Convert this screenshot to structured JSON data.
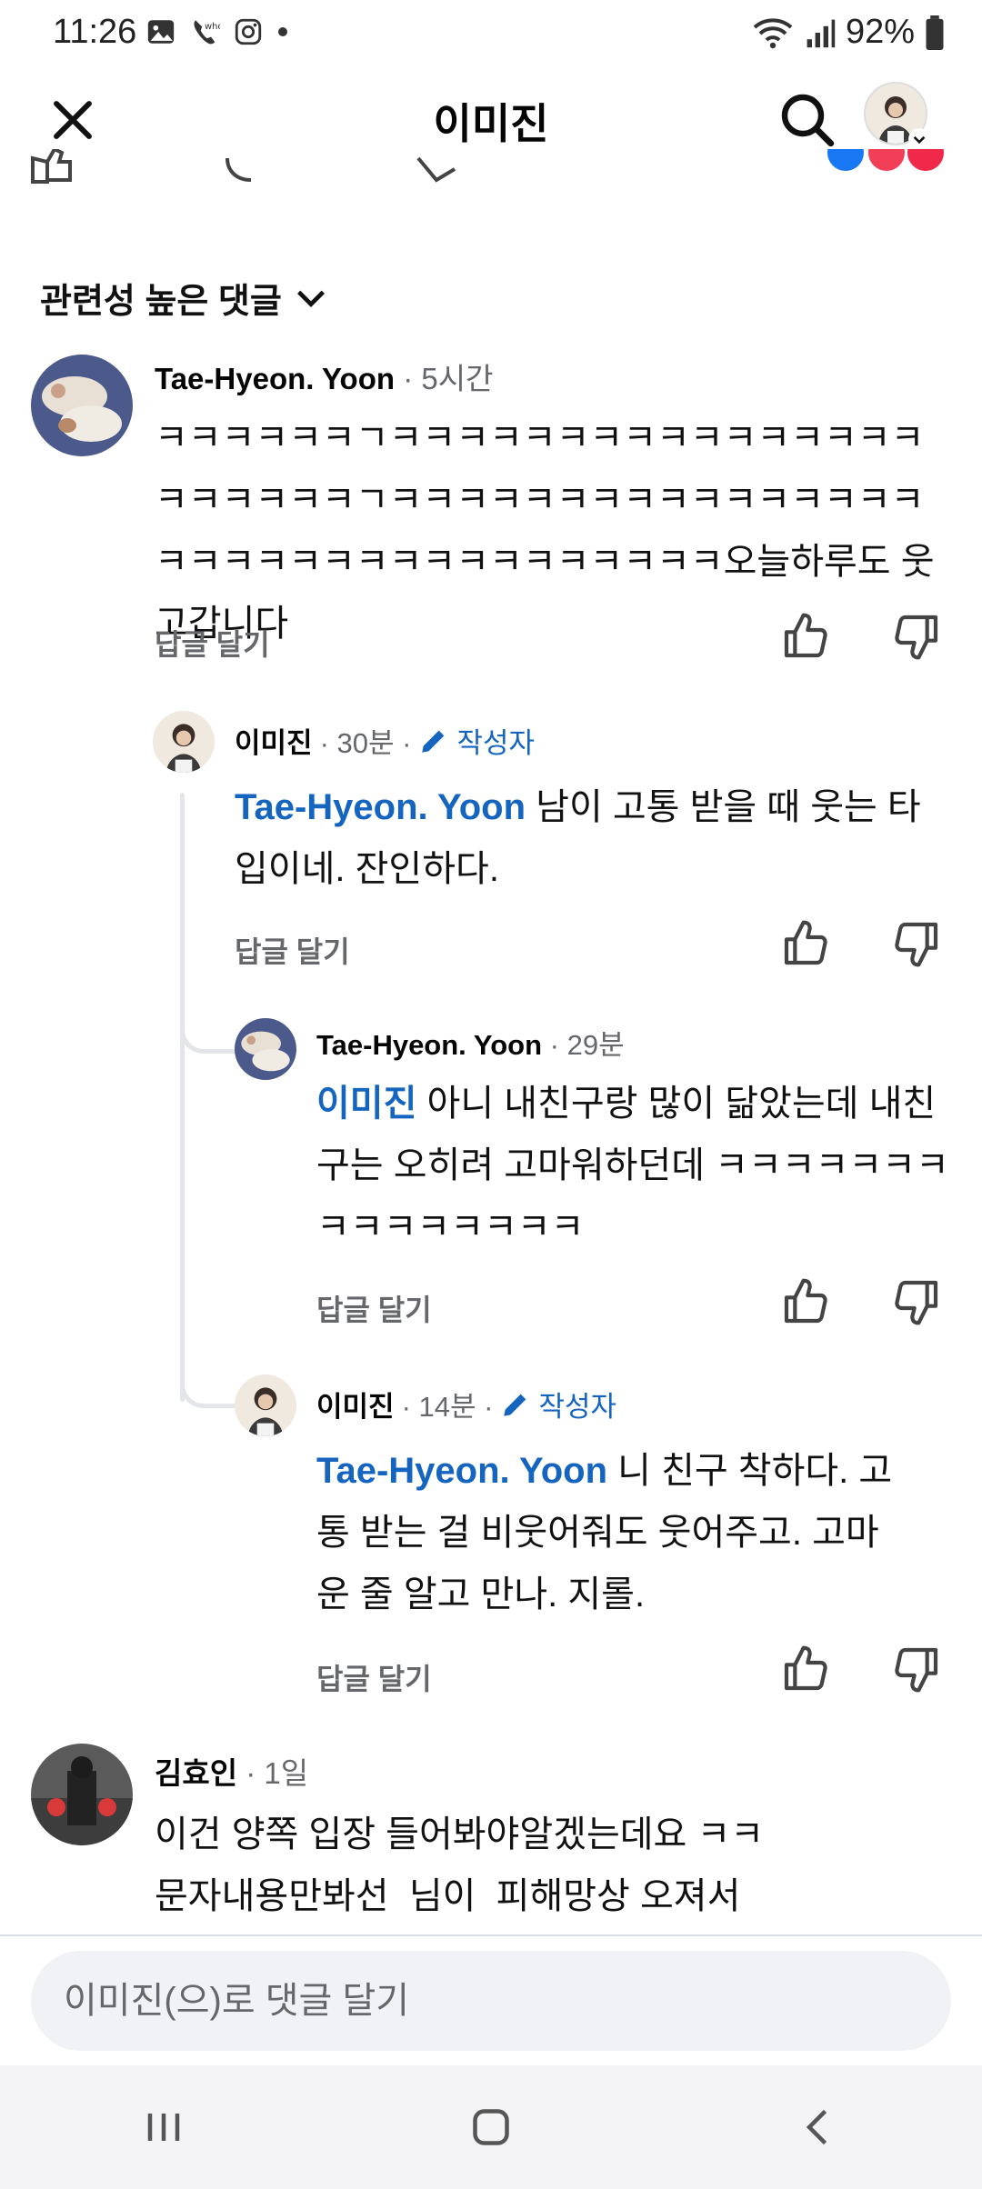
{
  "status_bar": {
    "time": "11:26",
    "battery": "92%"
  },
  "header": {
    "title": "이미진"
  },
  "sort": {
    "label": "관련성 높은 댓글"
  },
  "comments": [
    {
      "author": "Tae-Hyeon. Yoon",
      "time": "· 5시간",
      "text": "ㅋㅋㅋㅋㅋㅋㄱㅋㅋㅋㅋㅋㅋㅋㅋㅋㅋㅋㅋㅋㅋㅋㅋㅋㅋㅋㅋㅋㅋㄱㅋㅋㅋㅋㅋㅋㅋㅋㅋㅋㅋㅋㅋㅋㅋㅋㅋㅋㅋㅋㅋㅋㅋㅋㅋㅋㅋㅋㅋㅋㅋㅋㅋ오늘하루도 웃고갑니다",
      "reply_label": "답글 달기"
    },
    {
      "author": "이미진",
      "time": "· 30분 ·",
      "badge": "작성자",
      "mention": "Tae-Hyeon. Yoon",
      "text": " 남이 고통 받을 때 웃는 타입이네. 잔인하다.",
      "reply_label": "답글 달기"
    },
    {
      "author": "Tae-Hyeon. Yoon",
      "time": "· 29분",
      "mention": "이미진",
      "text": " 아니 내친구랑 많이 닮았는데 내친구는 오히려 고마워하던데 ㅋㅋㅋㅋㅋㅋㅋㅋㅋㅋㅋㅋㅋㅋㅋ",
      "reply_label": "답글 달기"
    },
    {
      "author": "이미진",
      "time": "· 14분 ·",
      "badge": "작성자",
      "mention": "Tae-Hyeon. Yoon",
      "text": " 니 친구 착하다. 고통 받는 걸 비웃어줘도 웃어주고. 고마운 줄 알고 만나. 지롤.",
      "reply_label": "답글 달기"
    },
    {
      "author": "김효인",
      "time": "· 1일",
      "text_line1": "이건 양쪽 입장 들어봐야알겠는데요 ㅋㅋ",
      "text_line2": "문자내용만봐선  님이  피해망상 오져서"
    }
  ],
  "input": {
    "placeholder": "이미진(으)로 댓글 달기"
  },
  "colors": {
    "mention": "#1565c0",
    "meta": "#65676b",
    "input_bg": "#f0f2f5"
  },
  "icons": [
    "close-icon",
    "search-icon",
    "chevron-down-icon",
    "edit-pencil-icon",
    "like-icon",
    "dislike-icon",
    "recents-icon",
    "home-icon",
    "back-icon"
  ]
}
